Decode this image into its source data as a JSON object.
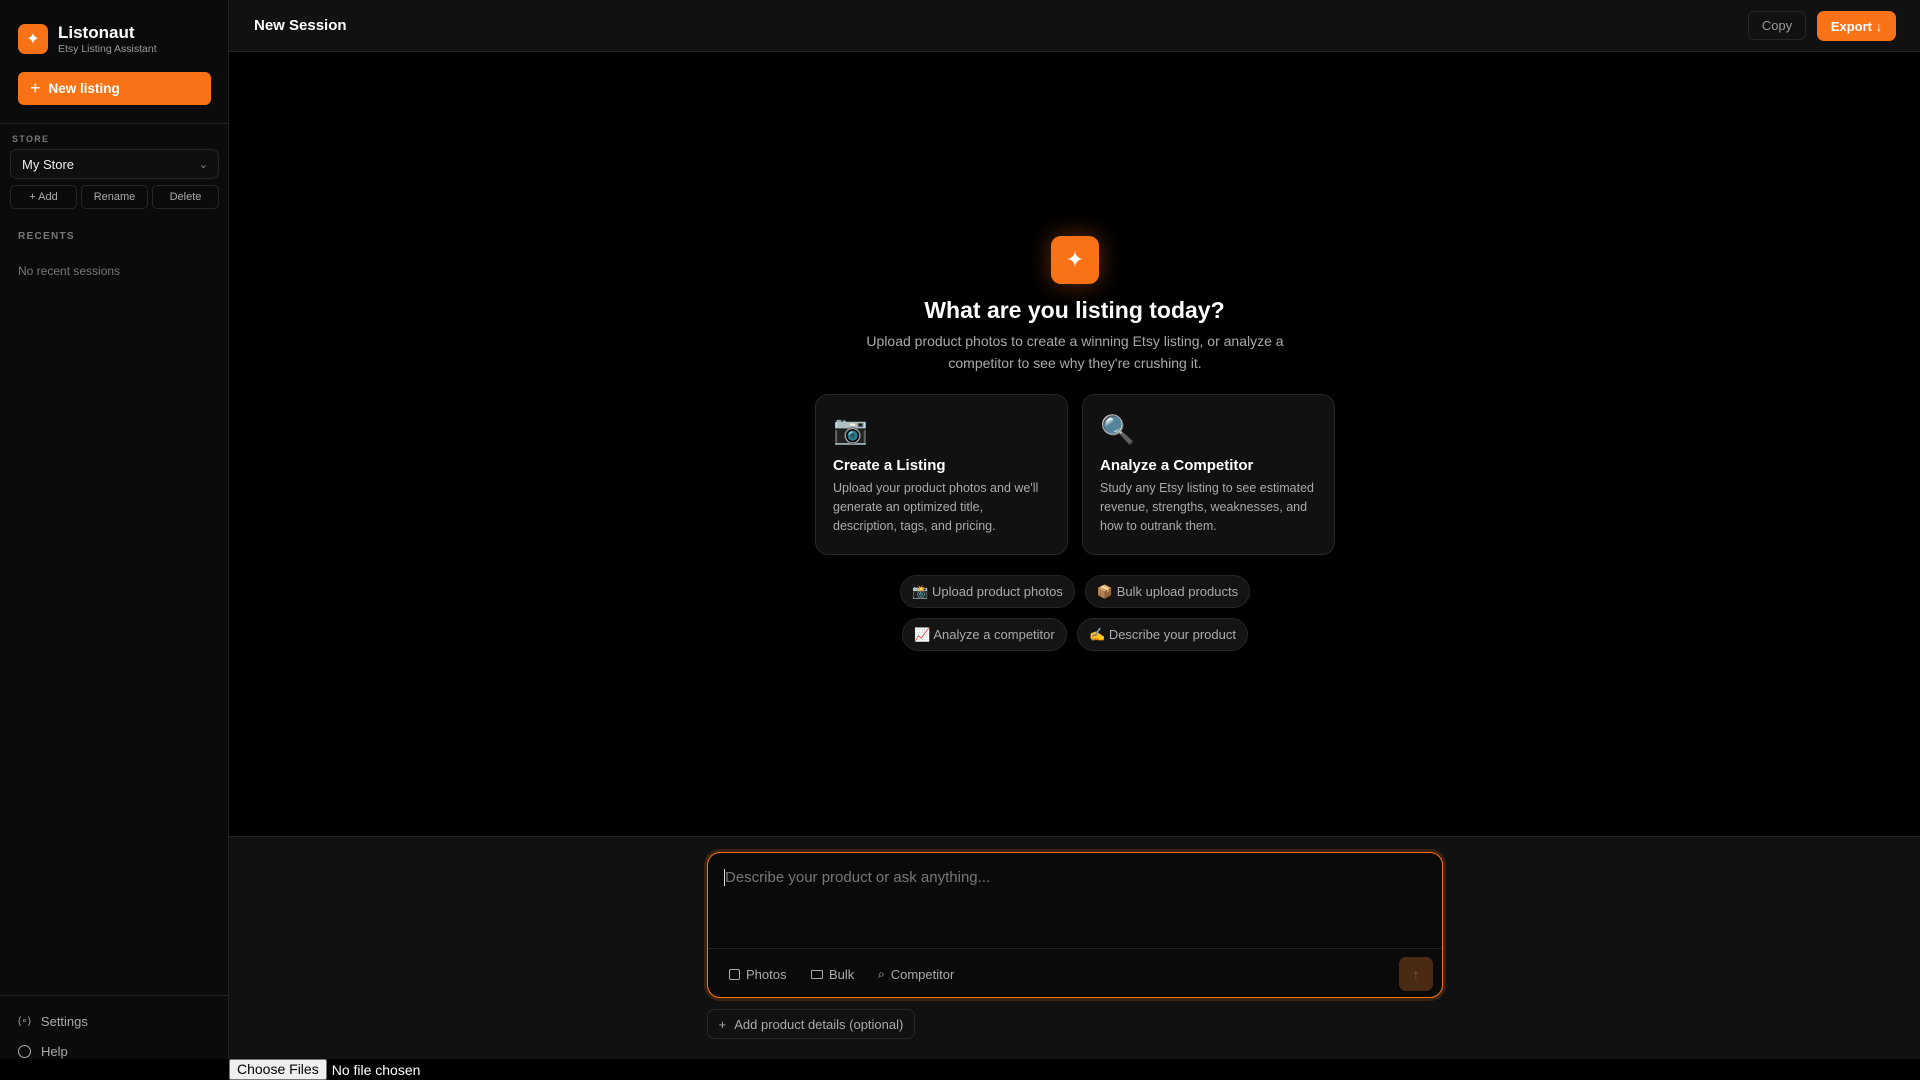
{
  "app": {
    "name": "Listonaut",
    "subtitle": "Etsy Listing Assistant",
    "logo_icon": "sparkle-icon",
    "accent": "#f97316"
  },
  "sidebar": {
    "new_listing": "New listing",
    "store_label": "STORE",
    "store_selected": "My Store",
    "store_actions": [
      "+ Add",
      "Rename",
      "Delete"
    ],
    "recents_label": "RECENTS",
    "recents_empty": "No recent sessions",
    "footer": [
      {
        "label": "Settings",
        "icon": "settings-icon"
      },
      {
        "label": "Help",
        "icon": "help-icon"
      }
    ]
  },
  "header": {
    "title": "New Session",
    "copy": "Copy",
    "export": "Export ↓"
  },
  "hero": {
    "title": "What are you listing today?",
    "subtitle": "Upload product photos to create a winning Etsy listing, or analyze a competitor to see why they're crushing it."
  },
  "cards": [
    {
      "emoji": "📷",
      "title": "Create a Listing",
      "desc": "Upload your product photos and we'll generate an optimized title, description, tags, and pricing."
    },
    {
      "emoji": "🔍",
      "title": "Analyze a Competitor",
      "desc": "Study any Etsy listing to see estimated revenue, strengths, weaknesses, and how to outrank them."
    }
  ],
  "chips": [
    "📸 Upload product photos",
    "📦 Bulk upload products",
    "📈 Analyze a competitor",
    "✍️ Describe your product"
  ],
  "composer": {
    "placeholder": "Describe your product or ask anything...",
    "tools": [
      "Photos",
      "Bulk",
      "Competitor"
    ],
    "add_details": "Add product details (optional)"
  },
  "file_input": {
    "button": "Choose Files",
    "status": "No file chosen"
  }
}
